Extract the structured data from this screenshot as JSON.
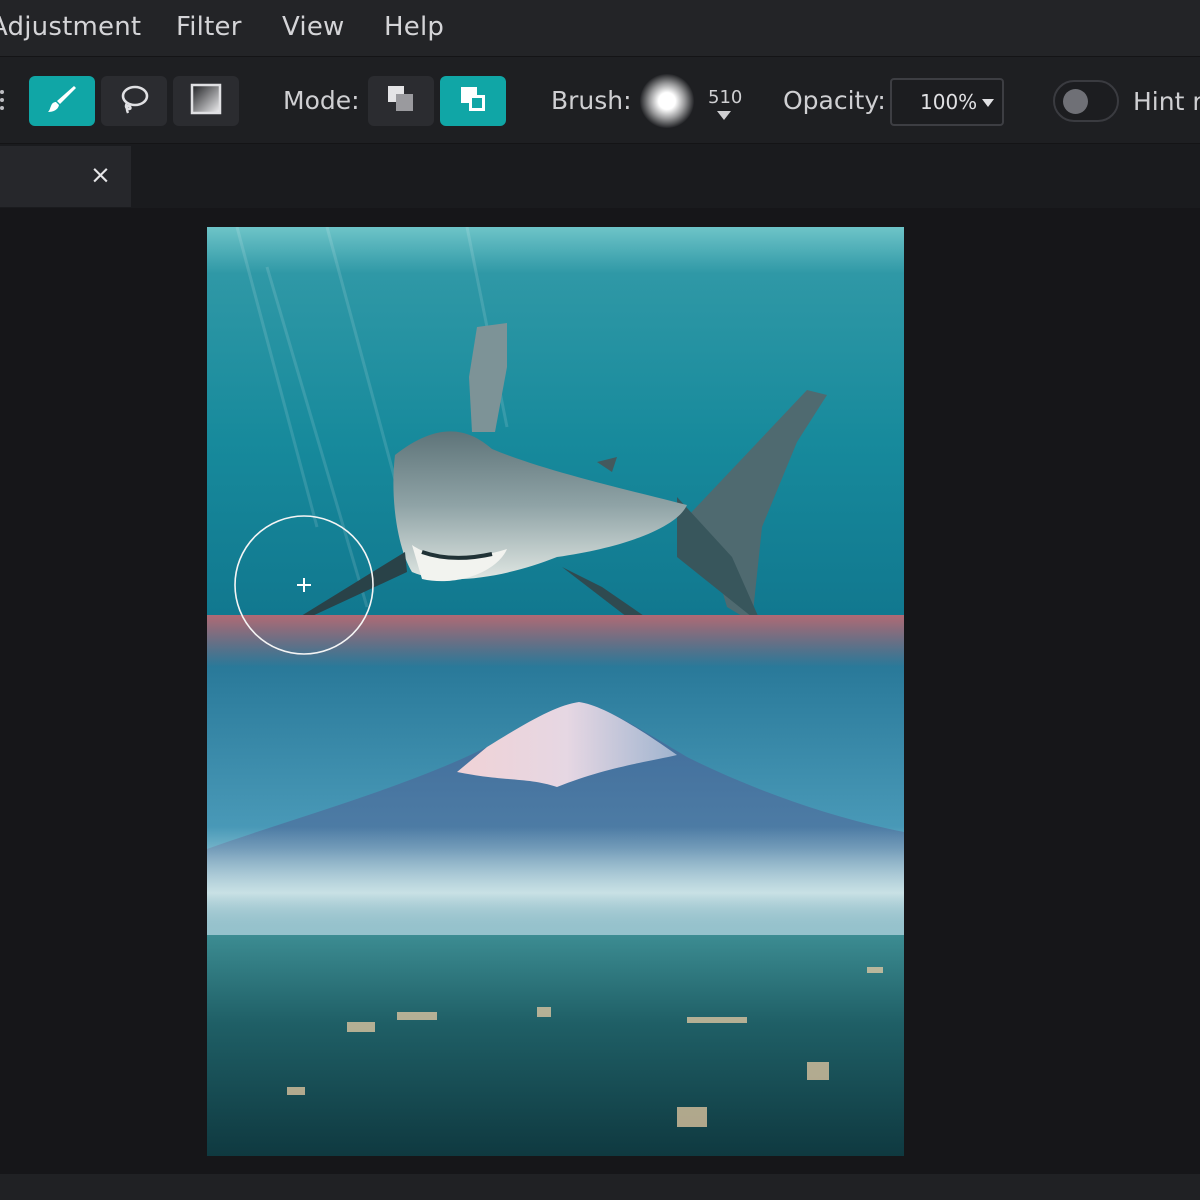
{
  "menubar": {
    "items": [
      "Adjustment",
      "Filter",
      "View",
      "Help"
    ]
  },
  "toolbar": {
    "tools": [
      {
        "name": "brush",
        "icon": "paintbrush-icon",
        "active": true
      },
      {
        "name": "lasso",
        "icon": "lasso-icon",
        "active": false
      },
      {
        "name": "gradient",
        "icon": "gradient-icon",
        "active": false
      }
    ],
    "mode_label": "Mode:",
    "modes": [
      {
        "icon": "subtract-mode-icon",
        "active": false
      },
      {
        "icon": "add-mode-icon",
        "active": true
      }
    ],
    "brush_label": "Brush:",
    "brush_size": "510",
    "opacity_label": "Opacity:",
    "opacity_value": "100%",
    "hint_label": "Hint r",
    "hint_enabled": false,
    "accent_color": "#10a6a6"
  },
  "tabs": {
    "close_symbol": "×"
  },
  "canvas": {
    "content": "composite image: shark underwater above mountain and city skyline"
  }
}
